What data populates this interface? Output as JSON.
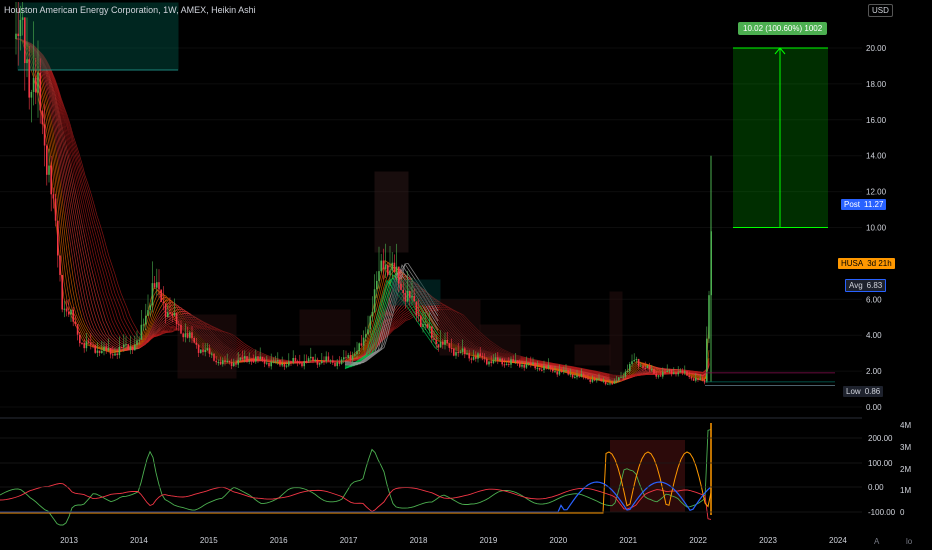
{
  "title": "Houston American Energy Corporation, 1W, AMEX, Heikin Ashi",
  "currency": "USD",
  "price_axis": [
    "20.00",
    "18.00",
    "16.00",
    "14.00",
    "12.00",
    "10.00",
    "6.00",
    "4.00",
    "2.00",
    "0.00"
  ],
  "indicator_axis_left": [
    "200.00",
    "100.00",
    "0.00",
    "-100.00"
  ],
  "indicator_axis_right": [
    "4M",
    "3M",
    "2M",
    "1M",
    "0"
  ],
  "year_labels": [
    "2013",
    "2014",
    "2015",
    "2016",
    "2017",
    "2018",
    "2019",
    "2020",
    "2021",
    "2022",
    "2023",
    "2024"
  ],
  "tags": {
    "post": {
      "label": "Post",
      "value": "11.27"
    },
    "symbol": {
      "label": "HUSA",
      "value": "3d 21h"
    },
    "avg": {
      "label": "Avg",
      "value": "6.83"
    },
    "low": {
      "label": "Low",
      "value": "0.86"
    }
  },
  "measure_label": "10.02 (100.60%) 1002",
  "footer": {
    "a": "A",
    "b": "lo"
  },
  "colors": {
    "bg": "#000000",
    "up": "#4caf50",
    "down": "#f23645",
    "orange": "#ff9800",
    "blue": "#2962ff",
    "measure": "#00ff00"
  },
  "chart_data": {
    "type": "line",
    "title": "Houston American Energy Corporation, 1W, AMEX, Heikin Ashi",
    "xlabel": "",
    "ylabel": "",
    "ylim": [
      0,
      21
    ],
    "series": [
      {
        "x": [
          2012.3,
          2012.5,
          2012.7,
          2012.9,
          2013.2,
          2013.6,
          2014.0,
          2014.2,
          2014.5,
          2014.8,
          2015.2,
          2015.6,
          2016.0,
          2016.5,
          2016.9,
          2017.2,
          2017.5,
          2017.8,
          2018.2,
          2018.6,
          2019.0,
          2019.5,
          2020.0,
          2020.4,
          2020.8,
          2021.1,
          2021.4,
          2021.7,
          2022.0,
          2022.1,
          2022.2
        ],
        "values": [
          20.5,
          18.0,
          14.0,
          6.0,
          3.5,
          3.0,
          3.6,
          6.8,
          4.8,
          3.5,
          2.4,
          2.7,
          2.4,
          2.6,
          2.5,
          3.4,
          8.3,
          6.5,
          3.8,
          3.0,
          2.6,
          2.4,
          2.0,
          1.6,
          1.3,
          2.6,
          1.8,
          2.0,
          1.5,
          1.4,
          11.27
        ]
      }
    ],
    "measure": {
      "from": 10.0,
      "to": 20.0,
      "label": "10.02 (100.60%) 1002"
    }
  }
}
